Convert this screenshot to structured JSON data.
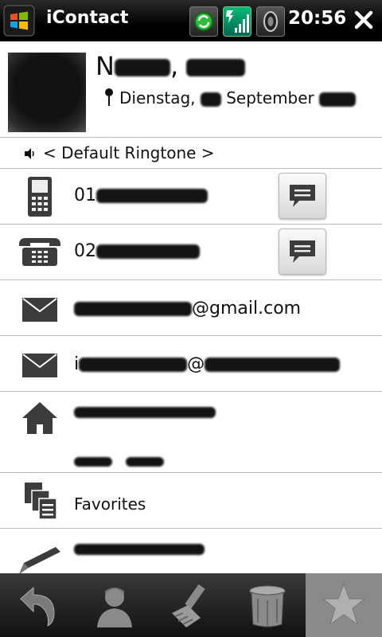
{
  "status_bar": {
    "app_title": "iContact",
    "clock": "20:56",
    "icons": [
      "windows-start-icon",
      "sync-icon",
      "signal-icon",
      "volume-icon",
      "close-icon"
    ]
  },
  "contact": {
    "name_prefix": "N",
    "name_sep": ", ",
    "birthday_day_label": "Dienstag,",
    "birthday_month": "September"
  },
  "ringtone": {
    "label": "< Default Ringtone >"
  },
  "phones": [
    {
      "type": "mobile-phone-icon",
      "visible_prefix": "01"
    },
    {
      "type": "desk-phone-icon",
      "visible_prefix": "02"
    }
  ],
  "emails": [
    {
      "visible_suffix": "@gmail.com"
    },
    {
      "visible_prefix": "i",
      "visible_mid": "@"
    }
  ],
  "favorites": {
    "label": "Favorites"
  },
  "toolbar": {
    "buttons": [
      "back-icon",
      "contact-icon",
      "edit-icon",
      "delete-icon",
      "favorite-star-icon"
    ],
    "active": "favorite-star-icon"
  },
  "colors": {
    "statusbar": "#000000",
    "toolbar_active": "#8a8a8a",
    "divider": "#bbbbbb"
  }
}
